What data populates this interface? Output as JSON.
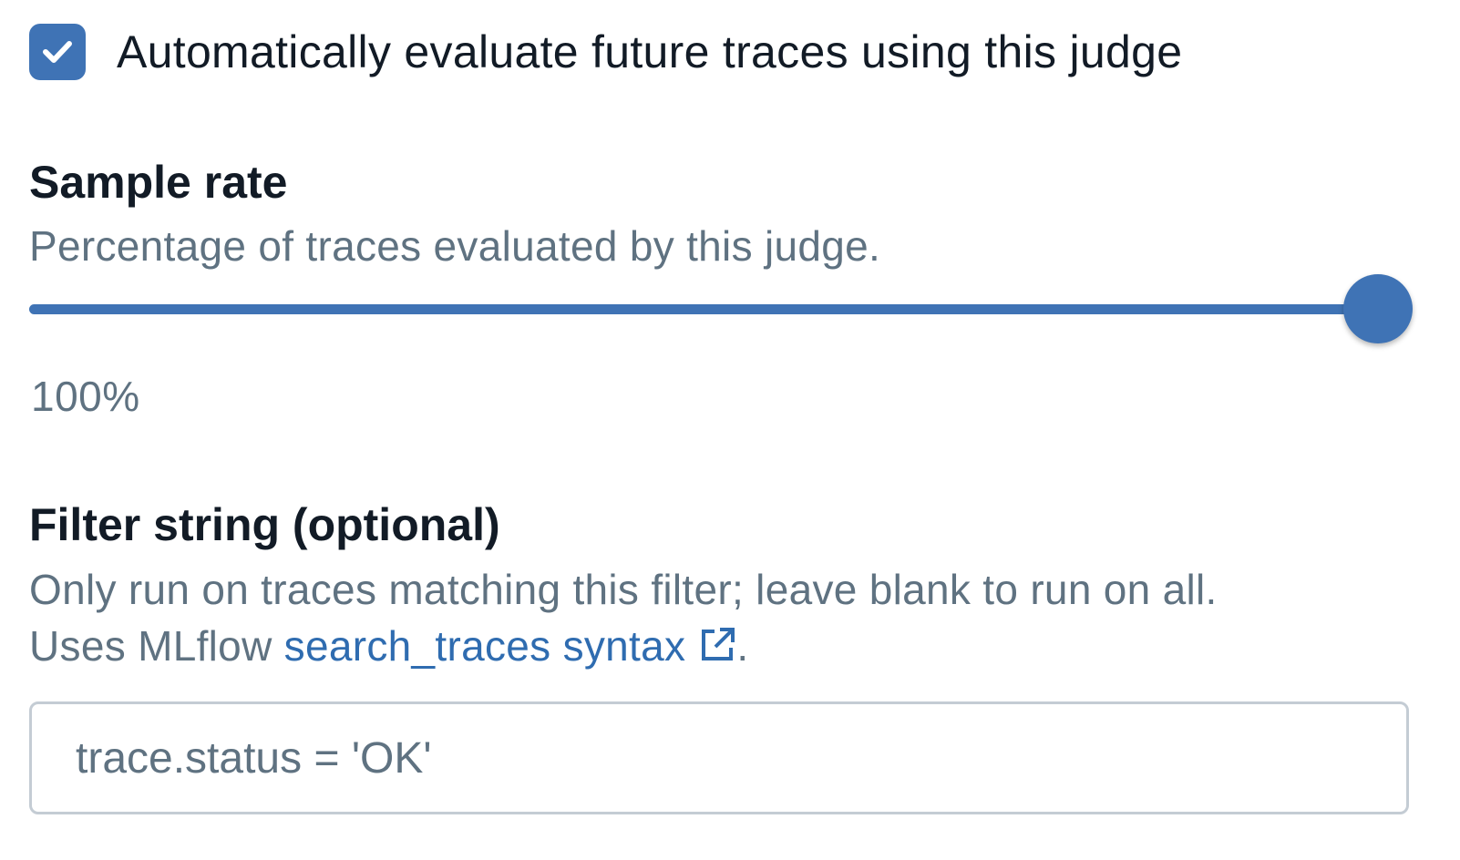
{
  "auto_evaluate": {
    "checked": true,
    "label": "Automatically evaluate future traces using this judge"
  },
  "sample_rate": {
    "title": "Sample rate",
    "description": "Percentage of traces evaluated by this judge.",
    "value_percent": 100,
    "value_label": "100%"
  },
  "filter_string": {
    "title": "Filter string (optional)",
    "description_line1": "Only run on traces matching this filter; leave blank to run on all.",
    "description_prefix": "Uses MLflow ",
    "link_text": "search_traces syntax",
    "link_icon": "external-link-icon",
    "description_suffix": ".",
    "input_value": "trace.status = 'OK'"
  },
  "colors": {
    "accent": "#3f73b5",
    "link": "#2f6cb0",
    "text_primary": "#121b26",
    "text_secondary": "#5f7281",
    "input_border": "#c4ccd4"
  }
}
